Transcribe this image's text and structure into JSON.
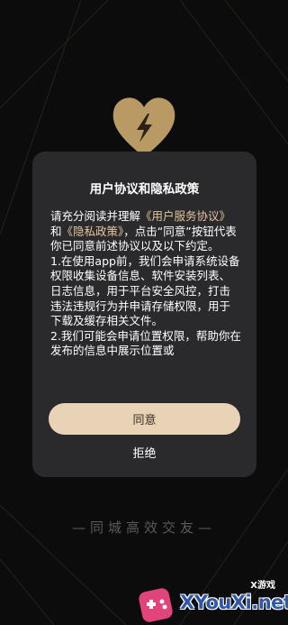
{
  "dialog": {
    "title": "用户协议和隐私政策",
    "intro": "请充分阅读并理解",
    "link_user_agreement": "《用户服务协议》",
    "conjunction": "和",
    "link_privacy_policy": "《隐私政策》",
    "after_links": "，点击“同意”按钮代表你已同意前述协议以及以下约定。",
    "clause_1": "1.在使用app前，我们会申请系统设备权限收集设备信息、软件安装列表、日志信息，用于平台安全风控，打击违法违规行为并申请存储权限，用于下载及缓存相关文件。",
    "clause_2": "2.我们可能会申请位置权限，帮助你在发布的信息中展示位置或",
    "agree_label": "同意",
    "reject_label": "拒绝"
  },
  "slogan": "—同城高效交友—",
  "watermark": {
    "small_text": "X游戏",
    "brand_text": "XYouXi.net"
  },
  "colors": {
    "background": "#0c0c0d",
    "dialog_bg": "#2a2a2c",
    "accent_gold": "#e9d3b6",
    "link_gold": "#e3c79e",
    "logo_gold": "#b99a64"
  },
  "icons": {
    "logo": "heart-lightning-icon",
    "watermark": "gamepad-icon"
  }
}
